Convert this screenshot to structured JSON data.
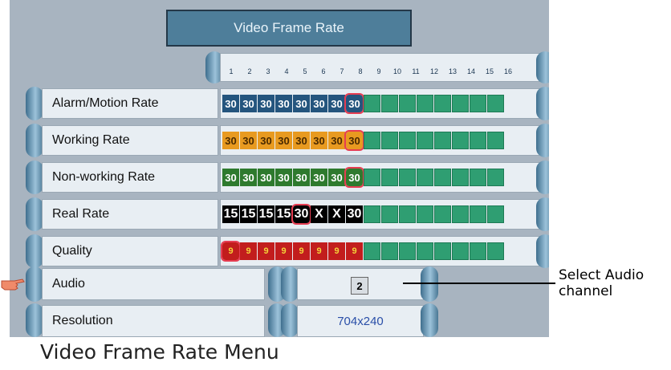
{
  "window": {
    "title": "Video Frame Rate"
  },
  "channels": [
    "1",
    "2",
    "3",
    "4",
    "5",
    "6",
    "7",
    "8",
    "9",
    "10",
    "11",
    "12",
    "13",
    "14",
    "15",
    "16"
  ],
  "rows": [
    {
      "label": "Alarm/Motion Rate",
      "values": [
        "30",
        "30",
        "30",
        "30",
        "30",
        "30",
        "30",
        "30"
      ],
      "selected_index": 7,
      "style": "blue"
    },
    {
      "label": "Working Rate",
      "values": [
        "30",
        "30",
        "30",
        "30",
        "30",
        "30",
        "30",
        "30"
      ],
      "selected_index": 7,
      "style": "orange"
    },
    {
      "label": "Non-working Rate",
      "values": [
        "30",
        "30",
        "30",
        "30",
        "30",
        "30",
        "30",
        "30"
      ],
      "selected_index": 7,
      "style": "green"
    },
    {
      "label": "Real Rate",
      "values": [
        "15",
        "15",
        "15",
        "15",
        "30",
        "X",
        "X",
        "30"
      ],
      "selected_index": 4,
      "style": "black"
    },
    {
      "label": "Quality",
      "values": [
        "9",
        "9",
        "9",
        "9",
        "9",
        "9",
        "9",
        "9"
      ],
      "selected_index": 0,
      "style": "red"
    }
  ],
  "audio": {
    "label": "Audio",
    "value": "2"
  },
  "resolution": {
    "label": "Resolution",
    "value": "704x240"
  },
  "callout": {
    "text_line1": "Select Audio",
    "text_line2": "channel"
  },
  "caption": "Video Frame Rate Menu",
  "colors": {
    "screen_bg": "#a8b4c0",
    "title_bg": "#4e7e9a",
    "highlight": "#e63d52"
  }
}
